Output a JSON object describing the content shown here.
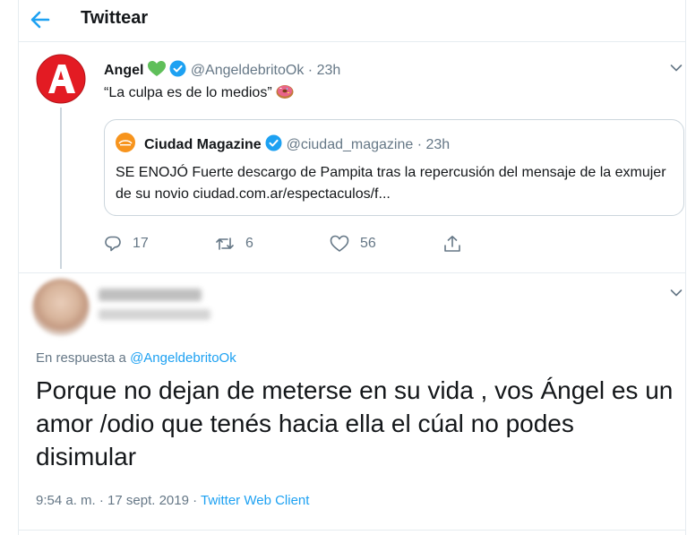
{
  "header": {
    "title": "Twittear",
    "back_icon": "arrow-left-icon"
  },
  "colors": {
    "accent": "#1da1f2",
    "secondary_text": "#657786",
    "logo_red": "#e31b23",
    "heart": "#5fbf5a"
  },
  "tweet": {
    "author_name": "Angel",
    "author_emoji": "green-heart-icon",
    "verified_icon": "verified-badge-icon",
    "handle_time": "@AngeldebritoOk · 23h",
    "text": "“La culpa es de lo medios”",
    "text_emoji": "doughnut-icon",
    "quote": {
      "author_name": "Ciudad Magazine",
      "handle_time": "@ciudad_magazine · 23h",
      "text": "SE ENOJÓ Fuerte descargo de Pampita tras la repercusión del mensaje de la exmujer de su novio ciudad.com.ar/espectaculos/f..."
    },
    "actions": {
      "replies": "17",
      "retweets": "6",
      "likes": "56"
    }
  },
  "reply": {
    "in_reply_prefix": "En respuesta a ",
    "in_reply_mention": "@AngeldebritoOk",
    "text": "Porque no dejan de meterse en su vida , vos Ángel es un amor /odio que tenés hacia ella el cúal no podes disimular",
    "timestamp": "9:54 a. m. · 17 sept. 2019 · ",
    "client": "Twitter Web Client"
  }
}
